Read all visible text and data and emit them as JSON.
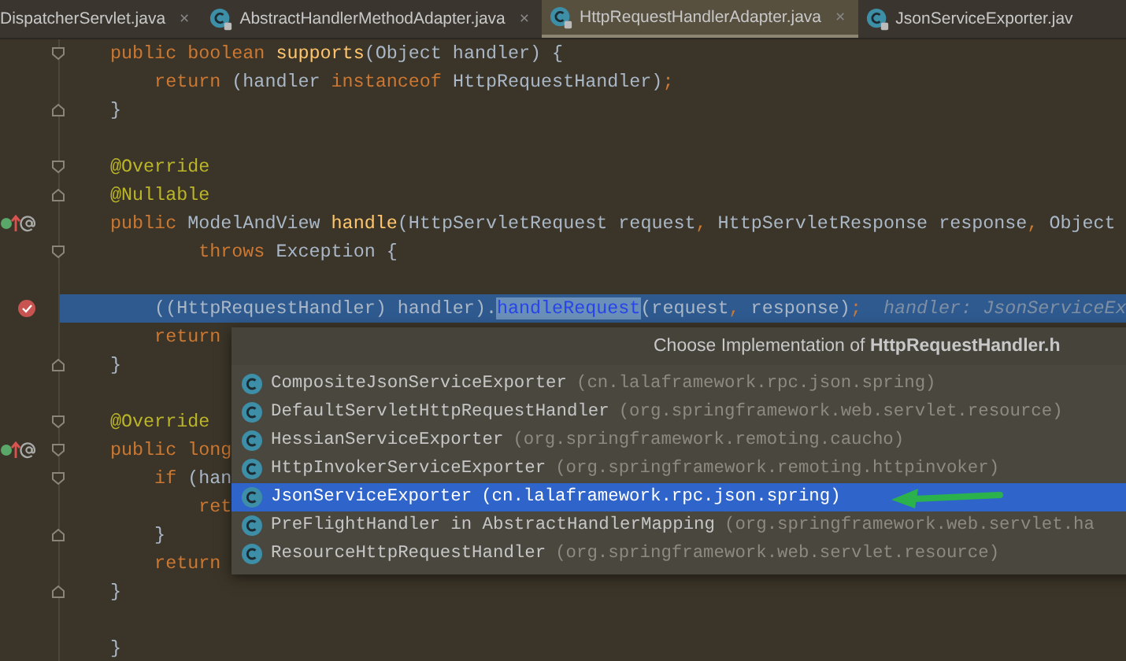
{
  "tabs": [
    {
      "label": "DispatcherServlet.java",
      "selected": false,
      "icon": false,
      "closable": true
    },
    {
      "label": "AbstractHandlerMethodAdapter.java",
      "selected": false,
      "icon": true,
      "closable": true
    },
    {
      "label": "HttpRequestHandlerAdapter.java",
      "selected": true,
      "icon": true,
      "closable": true
    },
    {
      "label": "JsonServiceExporter.jav",
      "selected": false,
      "icon": true,
      "closable": false
    }
  ],
  "close_glyph": "×",
  "editor": {
    "lines": [
      {
        "override": false,
        "breakpoint": false,
        "fold_open": true,
        "fold_close": false,
        "tokens": [
          {
            "kind": "kw",
            "text": "public boolean "
          },
          {
            "kind": "method",
            "text": "supports"
          },
          {
            "kind": "plain",
            "text": "(Object handler) {"
          }
        ]
      },
      {
        "override": false,
        "breakpoint": false,
        "fold_open": false,
        "fold_close": false,
        "tokens": [
          {
            "kind": "kw",
            "text": "    return "
          },
          {
            "kind": "plain",
            "text": "(handler "
          },
          {
            "kind": "kw",
            "text": "instanceof "
          },
          {
            "kind": "plain",
            "text": "HttpRequestHandler)"
          },
          {
            "kind": "punct",
            "text": ";"
          }
        ]
      },
      {
        "override": false,
        "breakpoint": false,
        "fold_open": false,
        "fold_close": true,
        "tokens": [
          {
            "kind": "plain",
            "text": "}"
          }
        ]
      },
      {
        "override": false,
        "breakpoint": false,
        "fold_open": false,
        "fold_close": false
      },
      {
        "override": false,
        "breakpoint": false,
        "fold_open": true,
        "fold_close": false,
        "tokens": [
          {
            "kind": "ann",
            "text": "@Override"
          }
        ]
      },
      {
        "override": false,
        "breakpoint": false,
        "fold_open": false,
        "fold_close": true,
        "tokens": [
          {
            "kind": "ann",
            "text": "@Nullable"
          }
        ]
      },
      {
        "override": true,
        "breakpoint": false,
        "fold_open": false,
        "fold_close": false,
        "tokens": [
          {
            "kind": "kw",
            "text": "public "
          },
          {
            "kind": "plain",
            "text": "ModelAndView "
          },
          {
            "kind": "method",
            "text": "handle"
          },
          {
            "kind": "plain",
            "text": "(HttpServletRequest request"
          },
          {
            "kind": "punct",
            "text": ","
          },
          {
            "kind": "plain",
            "text": " HttpServletResponse response"
          },
          {
            "kind": "punct",
            "text": ","
          },
          {
            "kind": "plain",
            "text": " Object"
          }
        ]
      },
      {
        "override": false,
        "breakpoint": false,
        "fold_open": true,
        "fold_close": false,
        "tokens": [
          {
            "kind": "kw",
            "text": "        throws "
          },
          {
            "kind": "plain",
            "text": "Exception {"
          }
        ]
      },
      {
        "override": false,
        "breakpoint": false,
        "fold_open": false,
        "fold_close": false
      },
      {
        "override": false,
        "breakpoint": true,
        "fold_open": false,
        "fold_close": false,
        "current": true,
        "tokens": [
          {
            "kind": "plain",
            "text": "    ((HttpRequestHandler) handler)."
          },
          {
            "kind": "usage",
            "text": "handleRequest"
          },
          {
            "kind": "plain",
            "text": "(request"
          },
          {
            "kind": "punct",
            "text": ","
          },
          {
            "kind": "plain",
            "text": " response)"
          },
          {
            "kind": "punct",
            "text": ";"
          },
          {
            "kind": "hint",
            "text": "  handler: JsonServiceEx"
          }
        ]
      },
      {
        "override": false,
        "breakpoint": false,
        "fold_open": false,
        "fold_close": false,
        "tokens": [
          {
            "kind": "kw",
            "text": "    return"
          }
        ]
      },
      {
        "override": false,
        "breakpoint": false,
        "fold_open": false,
        "fold_close": true,
        "tokens": [
          {
            "kind": "plain",
            "text": "}"
          }
        ]
      },
      {
        "override": false,
        "breakpoint": false,
        "fold_open": false,
        "fold_close": false
      },
      {
        "override": false,
        "breakpoint": false,
        "fold_open": true,
        "fold_close": false,
        "tokens": [
          {
            "kind": "ann",
            "text": "@Override"
          }
        ]
      },
      {
        "override": true,
        "breakpoint": false,
        "fold_open": true,
        "fold_close": false,
        "tokens": [
          {
            "kind": "kw",
            "text": "public long"
          }
        ]
      },
      {
        "override": false,
        "breakpoint": false,
        "fold_open": true,
        "fold_close": false,
        "tokens": [
          {
            "kind": "kw",
            "text": "    if "
          },
          {
            "kind": "plain",
            "text": "(han"
          }
        ]
      },
      {
        "override": false,
        "breakpoint": false,
        "fold_open": false,
        "fold_close": false,
        "tokens": [
          {
            "kind": "kw",
            "text": "        ret"
          }
        ]
      },
      {
        "override": false,
        "breakpoint": false,
        "fold_open": false,
        "fold_close": true,
        "tokens": [
          {
            "kind": "plain",
            "text": "    }"
          }
        ]
      },
      {
        "override": false,
        "breakpoint": false,
        "fold_open": false,
        "fold_close": false,
        "tokens": [
          {
            "kind": "kw",
            "text": "    return"
          }
        ]
      },
      {
        "override": false,
        "breakpoint": false,
        "fold_open": false,
        "fold_close": true,
        "tokens": [
          {
            "kind": "plain",
            "text": "}"
          }
        ]
      },
      {
        "override": false,
        "breakpoint": false,
        "fold_open": false,
        "fold_close": false
      },
      {
        "override": false,
        "breakpoint": false,
        "fold_open": false,
        "fold_close": false,
        "tokens": [
          {
            "kind": "plain",
            "text": "}"
          }
        ]
      }
    ]
  },
  "popup": {
    "title": "Choose Implementation of **HttpRequestHandler.h**",
    "items": [
      {
        "name": "CompositeJsonServiceExporter",
        "package": "(cn.lalaframework.rpc.json.spring)",
        "selected": false
      },
      {
        "name": "DefaultServletHttpRequestHandler",
        "package": "(org.springframework.web.servlet.resource)",
        "selected": false
      },
      {
        "name": "HessianServiceExporter",
        "package": "(org.springframework.remoting.caucho)",
        "selected": false
      },
      {
        "name": "HttpInvokerServiceExporter",
        "package": "(org.springframework.remoting.httpinvoker)",
        "selected": false
      },
      {
        "name": "JsonServiceExporter",
        "package": "(cn.lalaframework.rpc.json.spring)",
        "selected": true
      },
      {
        "name": "PreFlightHandler in AbstractHandlerMapping",
        "package": "(org.springframework.web.servlet.ha",
        "selected": false
      },
      {
        "name": "ResourceHttpRequestHandler",
        "package": "(org.springframework.web.servlet.resource)",
        "selected": false
      }
    ]
  }
}
